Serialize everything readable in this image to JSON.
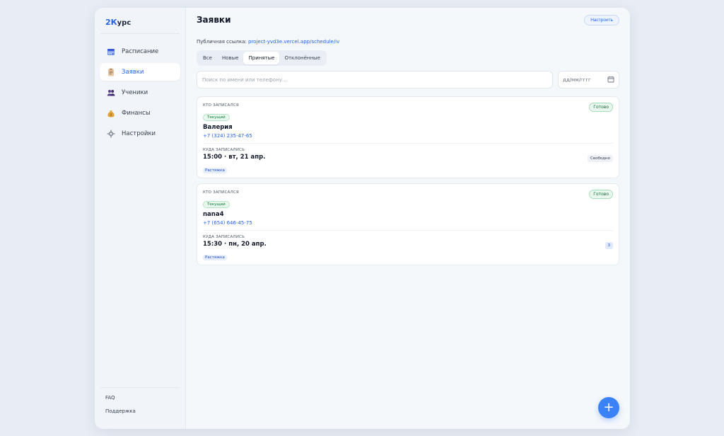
{
  "app": {
    "logo_prefix": "2",
    "logo_k": "К",
    "logo_suffix": "урс"
  },
  "sidebar": {
    "items": [
      {
        "label": "Расписание",
        "icon": "calendar-icon"
      },
      {
        "label": "Заявки",
        "icon": "clipboard-icon",
        "active": true
      },
      {
        "label": "Ученики",
        "icon": "users-icon"
      },
      {
        "label": "Финансы",
        "icon": "money-bag-icon"
      },
      {
        "label": "Настройки",
        "icon": "gear-icon"
      }
    ],
    "bottom": {
      "faq": "FAQ",
      "support": "Поддержка"
    }
  },
  "header": {
    "title": "Заявки",
    "setup_label": "Настроить"
  },
  "public_link": {
    "label": "Публичная ссылка:",
    "url": "project-yvd3e.vercel.app/schedule/iv"
  },
  "tabs": [
    "Все",
    "Новые",
    "Принятые",
    "Отклонённые"
  ],
  "active_tab": "Принятые",
  "search": {
    "placeholder": "Поиск по имени или телефону..."
  },
  "date_filter": {
    "placeholder": "дд/мм/гггг"
  },
  "requests": [
    {
      "who_label": "КТО ЗАПИСАЛСЯ",
      "current_badge": "Текущий",
      "name": "Валерия",
      "phone": "+7 (324) 235-47-65",
      "status": "Готово",
      "where_label": "КУДА ЗАПИСАЛИСЬ",
      "slot": "15:00 · вт, 21 апр.",
      "tag": "Растяжка",
      "right_badge": "Свободно"
    },
    {
      "who_label": "КТО ЗАПИСАЛСЯ",
      "current_badge": "Текущий",
      "name": "nana4",
      "phone": "+7 (654) 646-45-75",
      "status": "Готово",
      "where_label": "КУДА ЗАПИСАЛИСЬ",
      "slot": "15:30 · пн, 20 апр.",
      "tag": "Растяжка",
      "right_badge": "3"
    }
  ],
  "fab": {
    "label": "+"
  },
  "colors": {
    "accent": "#3b82f6",
    "link": "#2563eb",
    "success": "#15803d"
  }
}
